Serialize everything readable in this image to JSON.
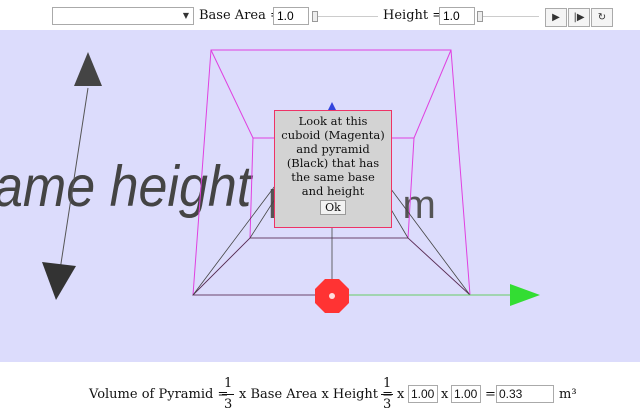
{
  "toolbar": {
    "select_value": "",
    "base_area_label": "Base Area =",
    "base_area_value": "1.0",
    "base_area_level": 0.0,
    "height_label": "Height =",
    "height_value": "1.0",
    "height_level": 0.0,
    "play_icon": "▶",
    "step_icon": "|▶",
    "reset_icon": "↻"
  },
  "stage": {
    "background": "#dcdcfc",
    "cuboid_color": "#e040e0",
    "pyramid_color": "#444444",
    "bg_text_left": "ame height",
    "bg_text_center": "h = 1.0 m",
    "dialog": {
      "message": "Look at this cuboid (Magenta) and pyramid (Black) that has the same base and height",
      "ok_label": "Ok"
    }
  },
  "formula": {
    "volume_label": "Volume of Pyramid =",
    "frac_num": "1",
    "frac_den": "3",
    "x_base_height": "x Base Area x Height =",
    "x1": "x",
    "base_value": "1.00",
    "x2": "x",
    "height_value": "1.00",
    "eq": "=",
    "result_value": "0.33",
    "unit": "m³"
  }
}
